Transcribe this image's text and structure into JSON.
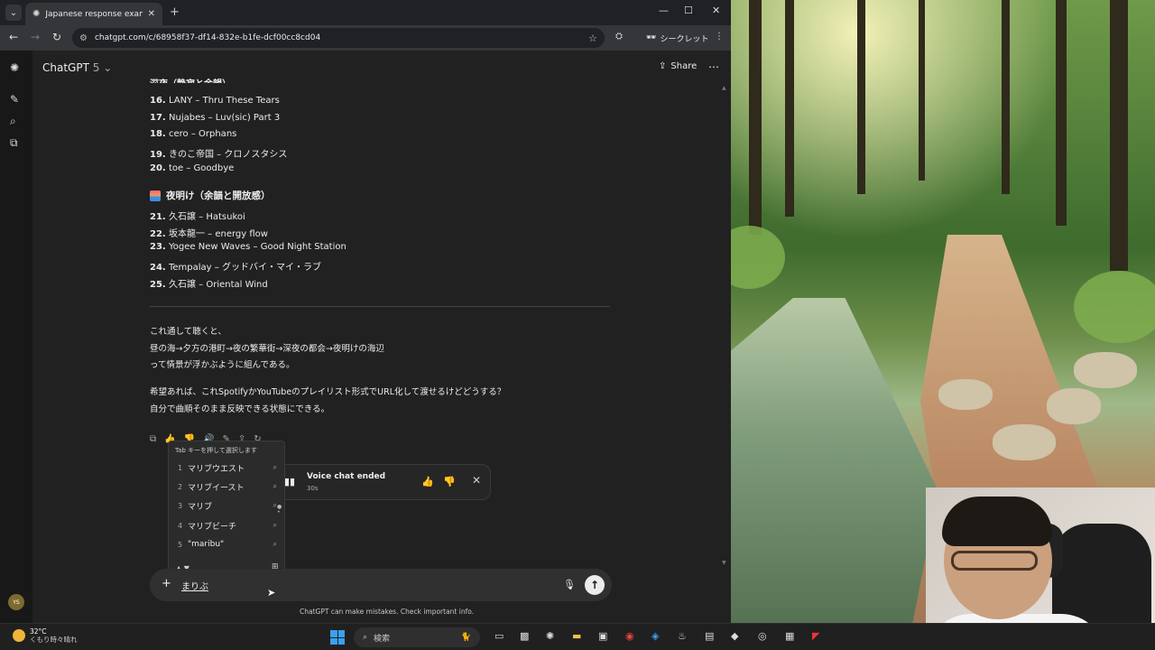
{
  "browser": {
    "tab_title": "Japanese response example",
    "url": "chatgpt.com/c/68958f37-df14-832e-b1fe-dcf00cc8cd04",
    "incognito_label": "シークレット"
  },
  "app": {
    "title": "ChatGPT",
    "version": "5",
    "share_label": "Share"
  },
  "chat": {
    "clipped_heading": "深夜（静寂と余韻）",
    "tracks_a": [
      {
        "num": "16.",
        "text": "LANY – Thru These Tears"
      },
      {
        "num": "17.",
        "text": "Nujabes – Luv(sic) Part 3"
      },
      {
        "num": "18.",
        "text": "cero – Orphans"
      },
      {
        "num": "19.",
        "text": "きのこ帝国 – クロノスタシス"
      },
      {
        "num": "20.",
        "text": "toe – Goodbye"
      }
    ],
    "section_heading": "夜明け（余韻と開放感）",
    "tracks_b": [
      {
        "num": "21.",
        "text": "久石譲 – Hatsukoi"
      },
      {
        "num": "22.",
        "text": "坂本龍一 – energy flow"
      },
      {
        "num": "23.",
        "text": "Yogee New Waves – Good Night Station"
      },
      {
        "num": "24.",
        "text": "Tempalay – グッドバイ・マイ・ラブ"
      },
      {
        "num": "25.",
        "text": "久石譲 – Oriental Wind"
      }
    ],
    "paragraph1": [
      "これ通して聴くと、",
      "昼の海→夕方の港町→夜の繁華街→深夜の都会→夜明けの海辺",
      "って情景が浮かぶように組んである。"
    ],
    "paragraph2": [
      "希望あれば、これSpotifyかYouTubeのプレイリスト形式でURL化して渡せるけどどうする？",
      "自分で曲順そのまま反映できる状態にできる。"
    ]
  },
  "voice": {
    "title": "Voice chat ended",
    "duration": "30s"
  },
  "ime": {
    "hint": "Tab キーを押して選択します",
    "candidates": [
      {
        "n": "1",
        "text": "マリブウエスト"
      },
      {
        "n": "2",
        "text": "マリブイースト"
      },
      {
        "n": "3",
        "text": "マリブ"
      },
      {
        "n": "4",
        "text": "マリブビーチ"
      },
      {
        "n": "5",
        "text": "\"maribu\""
      }
    ]
  },
  "composer": {
    "text": "まりぶ",
    "disclaimer": "ChatGPT can make mistakes. Check important info."
  },
  "avatar_initials": "YS",
  "taskbar": {
    "temperature": "32°C",
    "weather_desc": "くもり時々晴れ",
    "search_placeholder": "検索"
  },
  "icons": {
    "tab_list": "chevron-down-icon",
    "search": "search-icon",
    "send": "arrow-up-icon",
    "mic": "mic-icon"
  }
}
